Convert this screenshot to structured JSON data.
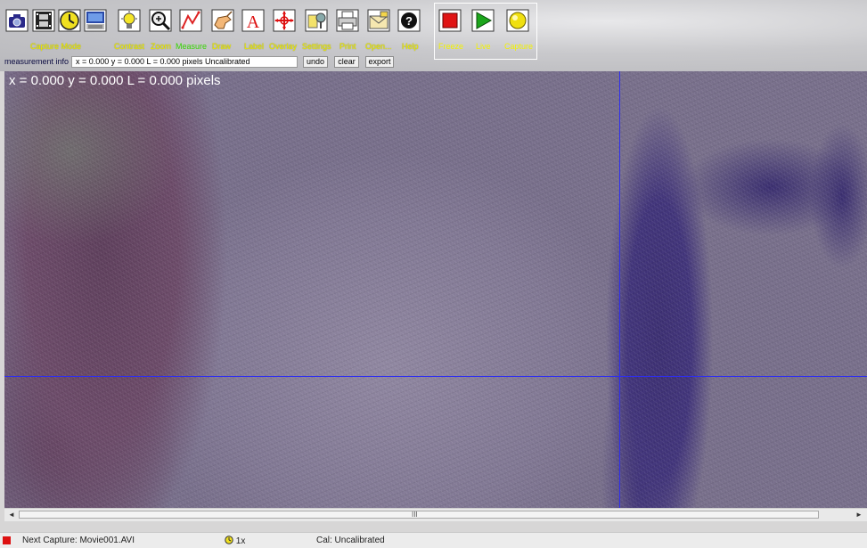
{
  "toolbar": {
    "capture_mode_label": "Capture Mode",
    "buttons": [
      {
        "name": "camera",
        "label": ""
      },
      {
        "name": "film",
        "label": ""
      },
      {
        "name": "timer",
        "label": ""
      },
      {
        "name": "monitor",
        "label": ""
      },
      {
        "name": "contrast",
        "label": "Contrast"
      },
      {
        "name": "zoom",
        "label": "Zoom"
      },
      {
        "name": "measure",
        "label": "Measure"
      },
      {
        "name": "draw",
        "label": "Draw"
      },
      {
        "name": "label",
        "label": "Label"
      },
      {
        "name": "overlay",
        "label": "Overlay"
      },
      {
        "name": "settings",
        "label": "Settings"
      },
      {
        "name": "print",
        "label": "Print"
      },
      {
        "name": "open",
        "label": "Open..."
      },
      {
        "name": "help",
        "label": "Help"
      }
    ],
    "live_group": {
      "freeze_label": "Freeze",
      "live_label": "Live",
      "capture_label": "Capture"
    }
  },
  "measurement": {
    "title": "measurement info",
    "value": "x = 0.000 y = 0.000 L = 0.000 pixels  Uncalibrated",
    "undo_label": "undo",
    "clear_label": "clear",
    "export_label": "export"
  },
  "viewport": {
    "overlay_text": "x = 0.000 y = 0.000 L = 0.000 pixels"
  },
  "scrollbar": {
    "left_arrow": "◄",
    "right_arrow": "►",
    "grip": "III"
  },
  "status": {
    "next_capture": "Next Capture: Movie001.AVI",
    "zoom": "1x",
    "calibration": "Cal: Uncalibrated"
  },
  "colors": {
    "toolbar_label": "#f2f200",
    "measure_label": "#36d400",
    "crosshair": "#2d2df0",
    "status_indicator": "#dd1111"
  }
}
